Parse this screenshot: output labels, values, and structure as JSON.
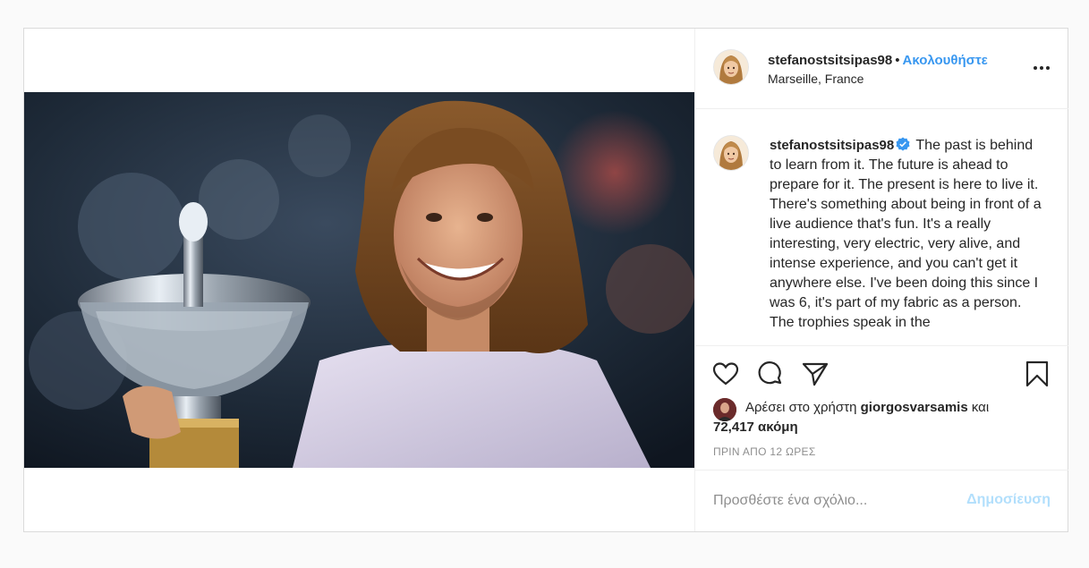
{
  "post": {
    "username": "stefanostsitsipas98",
    "separator": "•",
    "follow_label": "Ακολουθήστε",
    "location": "Marseille, France",
    "more_icon": "more-horizontal-icon",
    "photo_description_icon": "trophy-photo",
    "caption": {
      "username": "stefanostsitsipas98",
      "verified_icon": "verified-badge-icon",
      "text": "The past is behind to learn from it. The future is ahead to prepare for it. The present is here to live it. There's something about being in front of a live audience that's fun. It's a really interesting, very electric, very alive, and intense experience, and you can't get it anywhere else. I've been doing this since I was 6, it's part of my fabric as a person. The trophies speak in the"
    },
    "actions": {
      "like_icon": "heart-icon",
      "comment_icon": "comment-icon",
      "share_icon": "send-icon",
      "save_icon": "bookmark-icon"
    },
    "likes": {
      "prefix": "Αρέσει στο χρήστη",
      "user": "giorgosvarsamis",
      "conjunction": "και",
      "count": "72,417 ακόμη"
    },
    "timestamp": "ΠΡΙΝ ΑΠΟ 12 ΩΡΕΣ",
    "comment_placeholder": "Προσθέστε ένα σχόλιο...",
    "post_button": "Δημοσίευση"
  },
  "colors": {
    "link_blue": "#3897f0",
    "disabled_blue": "#b2dffc",
    "border": "#dbdbdb",
    "background": "#fafafa"
  }
}
